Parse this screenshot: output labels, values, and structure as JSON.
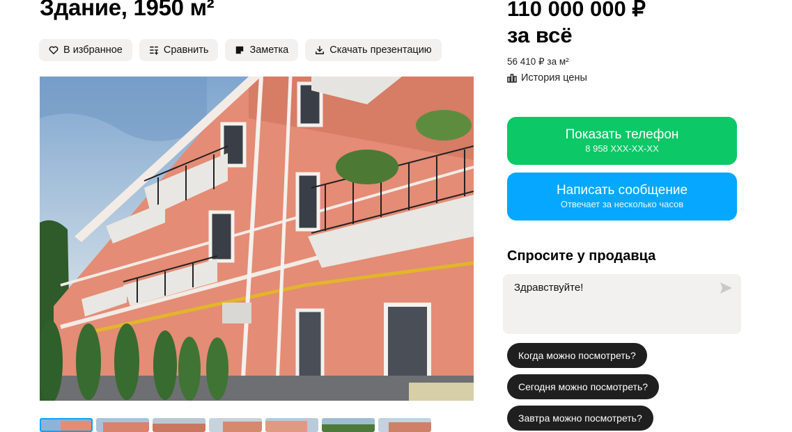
{
  "listing": {
    "title": "Здание, 1950 м²"
  },
  "actions": {
    "favorite": "В избранное",
    "compare": "Сравнить",
    "note": "Заметка",
    "download": "Скачать презентацию"
  },
  "pricing": {
    "price": "110 000 000 ₽",
    "price_suffix": "за всё",
    "per_sqm": "56 410 ₽ за м²",
    "history": "История цены"
  },
  "contact": {
    "phone_button": "Показать телефон",
    "phone_number": "8 958 XXX-XX-XX",
    "message_button": "Написать сообщение",
    "message_sub": "Отвечает за несколько часов"
  },
  "ask_seller": {
    "title": "Спросите у продавца",
    "message": "Здравствуйте!",
    "suggestions": [
      "Когда можно посмотреть?",
      "Сегодня можно посмотреть?",
      "Завтра можно посмотреть?"
    ]
  },
  "gallery": {
    "thumbnail_count": 7
  },
  "colors": {
    "green": "#0dc867",
    "blue": "#06a7ff",
    "chip_bg": "#1f1f1f",
    "button_bg": "#f2f1f0",
    "thumb_active": "#0aa3ff"
  }
}
